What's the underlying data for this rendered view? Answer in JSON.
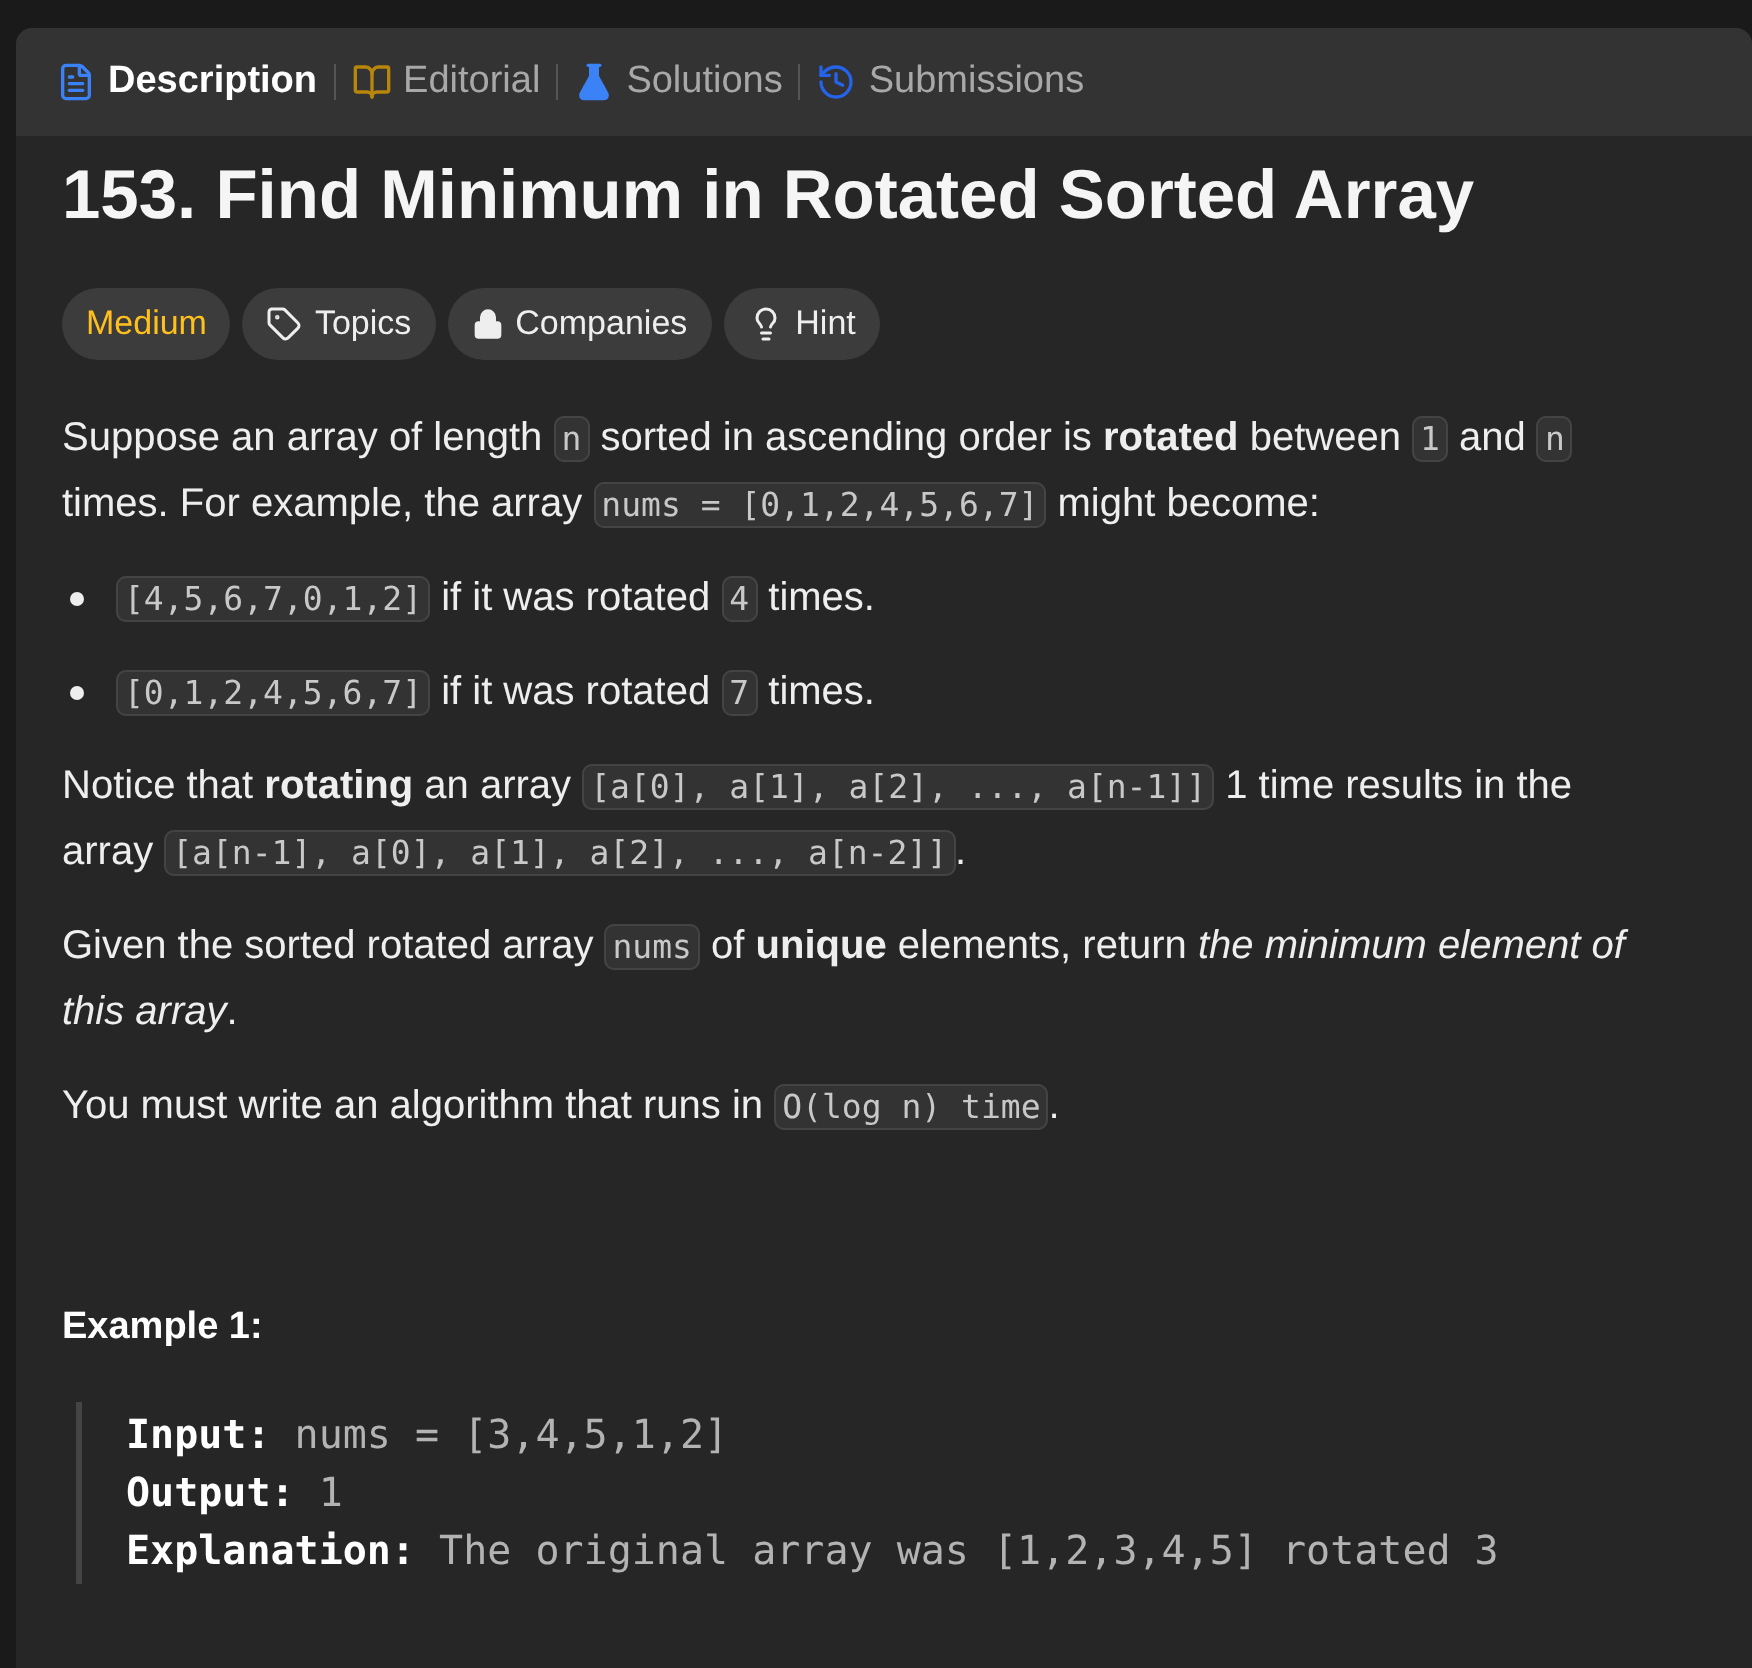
{
  "tabs": [
    {
      "label": "Description",
      "kind": "description",
      "selected": true
    },
    {
      "label": "Editorial",
      "kind": "editorial",
      "selected": false
    },
    {
      "label": "Solutions",
      "kind": "solutions",
      "selected": false
    },
    {
      "label": "Submissions",
      "kind": "submissions",
      "selected": false
    }
  ],
  "title": "153. Find Minimum in Rotated Sorted Array",
  "chips": [
    {
      "label": "Medium",
      "kind": "difficulty"
    },
    {
      "label": "Topics",
      "kind": "topics"
    },
    {
      "label": "Companies",
      "kind": "companies"
    },
    {
      "label": "Hint",
      "kind": "hint"
    }
  ],
  "blocks": [
    {
      "kind": "paragraph",
      "segments": [
        {
          "kind": "text",
          "text": "Suppose an array of length "
        },
        {
          "kind": "code",
          "text": "n"
        },
        {
          "kind": "text",
          "text": " sorted in ascending order is **rotated** between "
        },
        {
          "kind": "code",
          "text": "1"
        },
        {
          "kind": "text",
          "text": " and "
        },
        {
          "kind": "code",
          "text": "n"
        },
        {
          "kind": "text",
          "text": " times. For example, the array "
        },
        {
          "kind": "code",
          "text": "nums = [0,1,2,4,5,6,7]"
        },
        {
          "kind": "text",
          "text": " might become:"
        }
      ]
    },
    {
      "kind": "bullet",
      "segments": [
        {
          "kind": "code",
          "text": "[4,5,6,7,0,1,2]"
        },
        {
          "kind": "text",
          "text": " if it was rotated "
        },
        {
          "kind": "code",
          "text": "4"
        },
        {
          "kind": "text",
          "text": " times."
        }
      ]
    },
    {
      "kind": "bullet",
      "segments": [
        {
          "kind": "code",
          "text": "[0,1,2,4,5,6,7]"
        },
        {
          "kind": "text",
          "text": " if it was rotated "
        },
        {
          "kind": "code",
          "text": "7"
        },
        {
          "kind": "text",
          "text": " times."
        }
      ]
    },
    {
      "kind": "paragraph",
      "segments": [
        {
          "kind": "text",
          "text": "Notice that **rotating** an array "
        },
        {
          "kind": "code",
          "text": "[a[0], a[1], a[2], ..., a[n-1]]"
        },
        {
          "kind": "text",
          "text": " 1 time results in the array "
        },
        {
          "kind": "code",
          "text": "[a[n-1], a[0], a[1], a[2], ..., a[n-2]]"
        },
        {
          "kind": "text",
          "text": "."
        }
      ]
    },
    {
      "kind": "paragraph",
      "segments": [
        {
          "kind": "text",
          "text": "Given the sorted rotated array "
        },
        {
          "kind": "code",
          "text": "nums"
        },
        {
          "kind": "text",
          "text": " of **unique** elements, return *the minimum element of this array*."
        }
      ]
    },
    {
      "kind": "paragraph",
      "segments": [
        {
          "kind": "text",
          "text": "You must write an algorithm that runs in "
        },
        {
          "kind": "code",
          "text": "O(log n) time"
        },
        {
          "kind": "text",
          "text": "."
        }
      ]
    }
  ],
  "example": {
    "heading": "Example 1:",
    "lines": [
      {
        "label": "Input:",
        "value": "nums = [3,4,5,1,2]"
      },
      {
        "label": "Output:",
        "value": "1"
      },
      {
        "label": "Explanation:",
        "value": "The original array was [1,2,3,4,5] rotated 3"
      }
    ]
  }
}
